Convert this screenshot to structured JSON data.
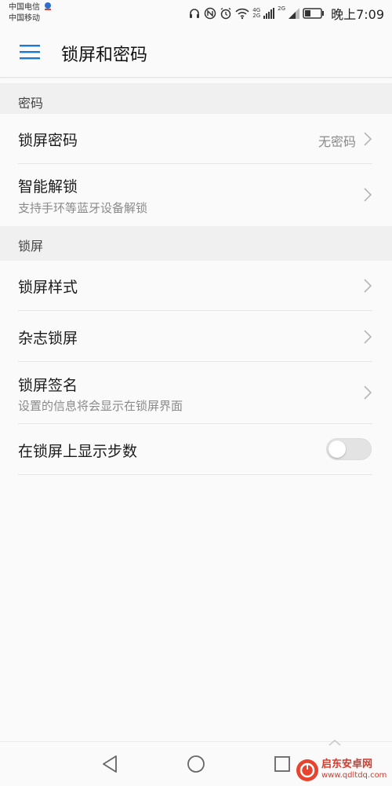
{
  "status_bar": {
    "carrier_1": "中国电信",
    "carrier_2": "中国移动",
    "net_4g": "4G",
    "net_2g_a": "2G",
    "net_2g_b": "2G",
    "time": "晚上7:09"
  },
  "header": {
    "title": "锁屏和密码",
    "menu_icon": "hamburger-menu-icon"
  },
  "sections": [
    {
      "heading": "密码",
      "items": [
        {
          "title": "锁屏密码",
          "value": "无密码",
          "chevron": true
        },
        {
          "title": "智能解锁",
          "subtitle": "支持手环等蓝牙设备解锁",
          "chevron": true
        }
      ]
    },
    {
      "heading": "锁屏",
      "items": [
        {
          "title": "锁屏样式",
          "chevron": true
        },
        {
          "title": "杂志锁屏",
          "chevron": true
        },
        {
          "title": "锁屏签名",
          "subtitle": "设置的信息将会显示在锁屏界面",
          "chevron": true
        },
        {
          "title": "在锁屏上显示步数",
          "toggle_on": false
        }
      ]
    }
  ],
  "watermark": {
    "name": "启东安卓网",
    "url": "www.qdltdq.com"
  },
  "colors": {
    "accent": "#1a7ad6",
    "background": "#fafafa",
    "section_bg": "#f0f0f0",
    "secondary_text": "#8a8a8a"
  }
}
